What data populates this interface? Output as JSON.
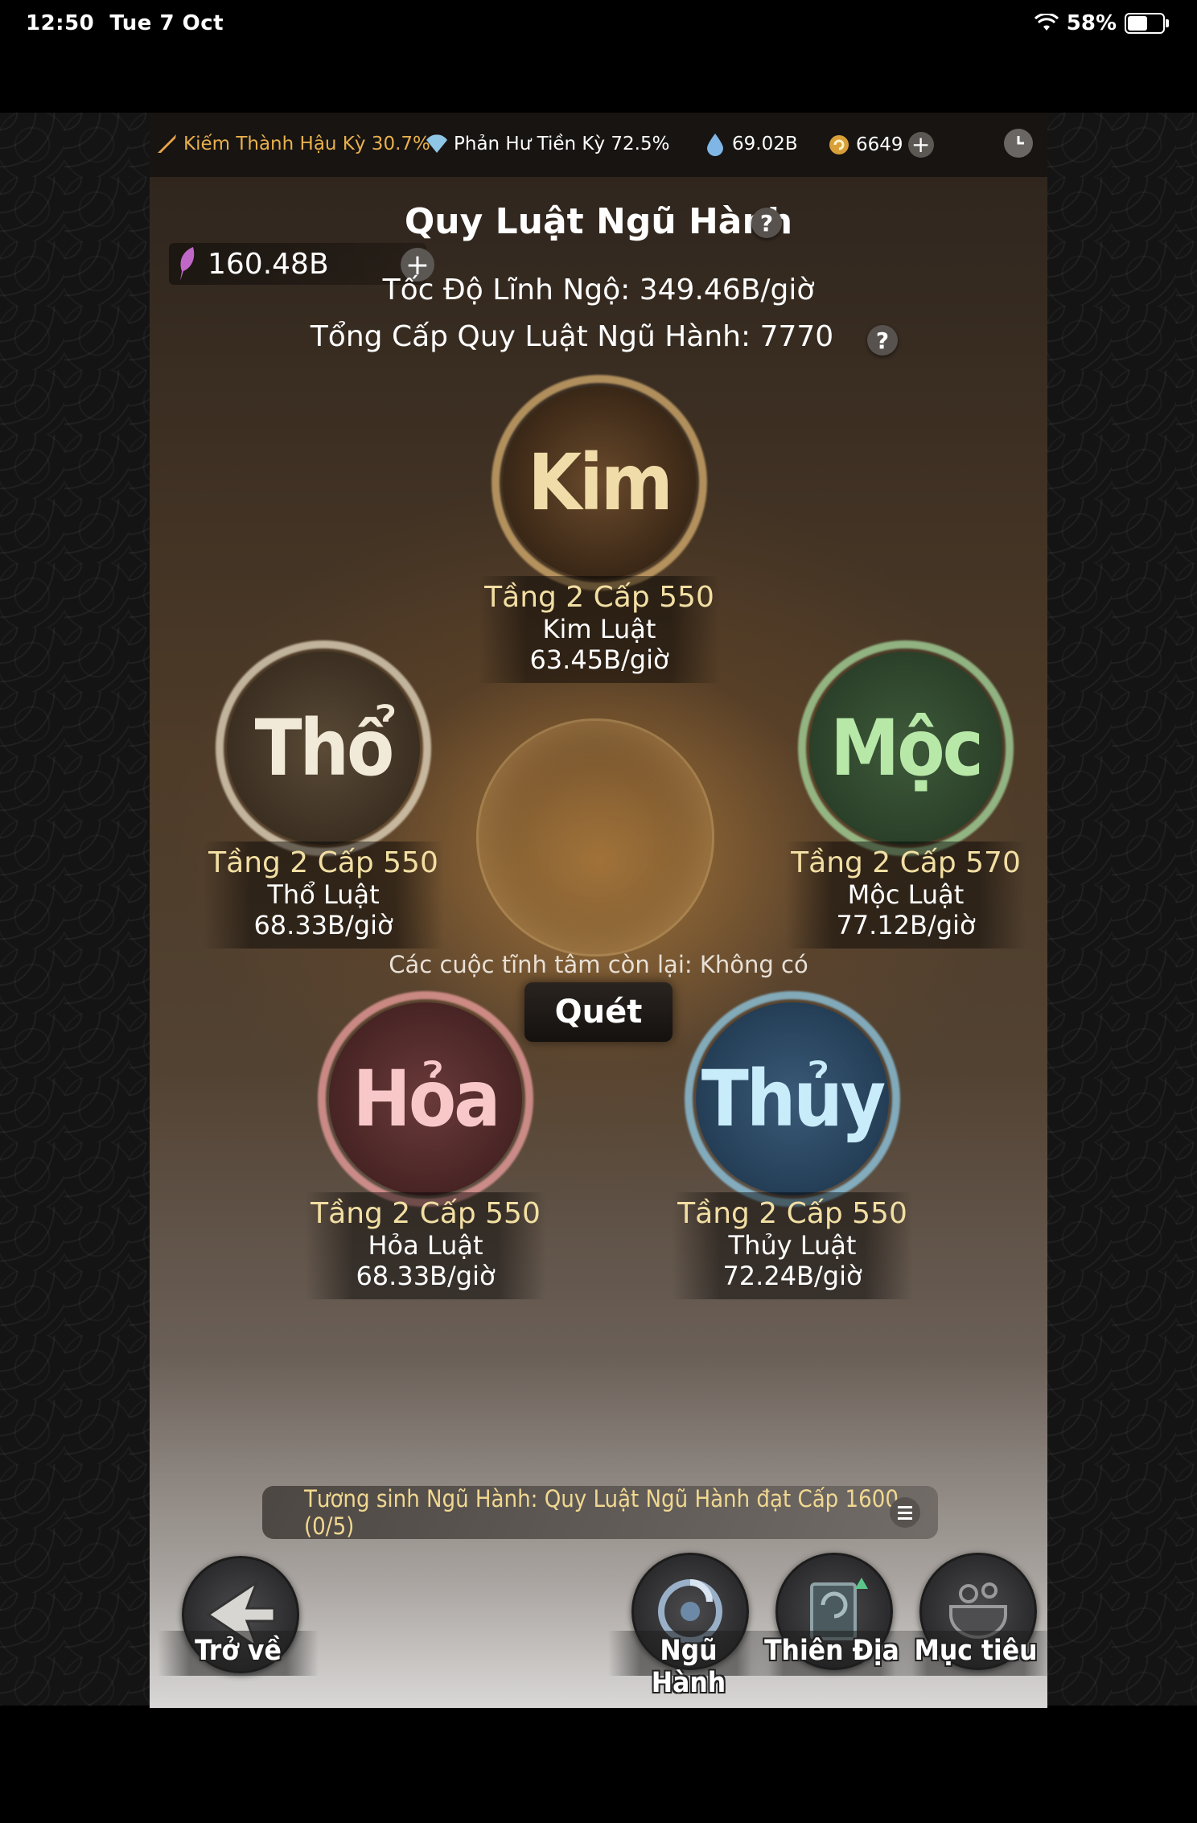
{
  "status_bar": {
    "time": "12:50",
    "date": "Tue 7 Oct",
    "battery_percent": "58%",
    "battery_level": 0.58
  },
  "top_bar": {
    "realm_1": "Kiếm Thành Hậu Kỳ 30.7%",
    "realm_2": "Phản Hư Tiền Kỳ 72.5%",
    "water_amount": "69.02B",
    "coin_amount": "6649",
    "plus": "+",
    "icons": [
      "sword-icon",
      "fan-icon",
      "water-drop-icon",
      "coin-icon",
      "clock-icon"
    ]
  },
  "page": {
    "title": "Quy Luật Ngũ Hành",
    "help": "?",
    "resource_value": "160.48B",
    "resource_plus": "+",
    "speed": "Tốc Độ Lĩnh Ngộ: 349.46B/giờ",
    "total_level": "Tổng Cấp Quy Luật Ngũ Hành: 7770"
  },
  "elements": {
    "kim": {
      "orb": "Kim",
      "tier": "Tầng 2 Cấp 550",
      "name": "Kim Luật",
      "rate": "63.45B/giờ",
      "color": "#e8c98a"
    },
    "tho": {
      "orb": "Thổ",
      "tier": "Tầng 2  Cấp 550",
      "name": "Thổ Luật",
      "rate": "68.33B/giờ",
      "color": "#e6d6b0"
    },
    "moc": {
      "orb": "Mộc",
      "tier": "Tầng 2  Cấp 570",
      "name": "Mộc Luật",
      "rate": "77.12B/giờ",
      "color": "#9fd6a0"
    },
    "hoa": {
      "orb": "Hỏa",
      "tier": "Tầng 2  Cấp 550",
      "name": "Hỏa Luật",
      "rate": "68.33B/giờ",
      "color": "#f2a0a0"
    },
    "thuy": {
      "orb": "Thủy",
      "tier": "Tầng 2  Cấp 550",
      "name": "Thủy Luật",
      "rate": "72.24B/giờ",
      "color": "#9fd6f0"
    }
  },
  "remaining": "Các cuộc tĩnh tâm còn lại: Không có",
  "scan_button": "Quét",
  "goal": "Tương sinh Ngũ Hành: Quy Luật Ngũ Hành đạt Cấp 1600 (0/5)",
  "nav": {
    "back": "Trở về",
    "ngu_hanh": "Ngũ Hành",
    "thien_dia": "Thiên Địa",
    "muc_tieu": "Mục tiêu"
  }
}
